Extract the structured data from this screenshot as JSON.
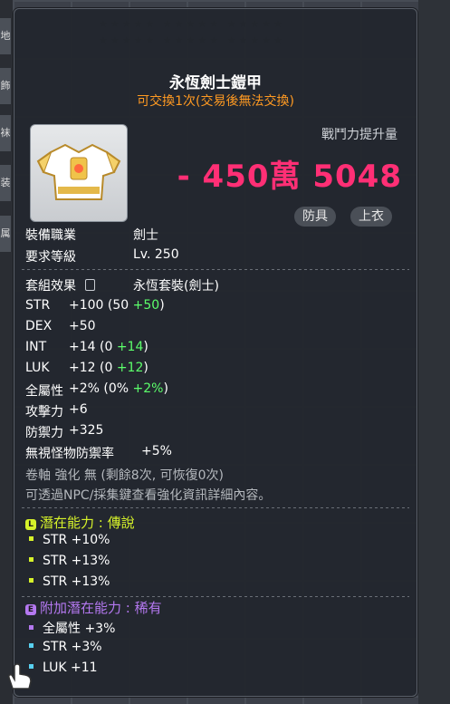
{
  "background": {
    "left_chars": [
      "地",
      "飾",
      "袜",
      "装",
      "属"
    ]
  },
  "item": {
    "name": "永恆劍士鎧甲",
    "trade_note": "可交換1次(交易後無法交換)",
    "combat_power_label": "戰鬥力提升量",
    "combat_power_value": "- 450萬 5048",
    "tags": [
      "防具",
      "上衣"
    ],
    "req_job_label": "裝備職業",
    "req_job_value": "劍士",
    "req_level_label": "要求等級",
    "req_level_value": "Lv. 250"
  },
  "set_effect": {
    "label": "套組效果",
    "value": "永恆套裝(劍士)"
  },
  "stats": [
    {
      "name": "STR",
      "total": "+100",
      "detail_open": "(50 ",
      "bonus": "+50",
      "detail_close": ")"
    },
    {
      "name": "DEX",
      "total": "+50",
      "detail_open": "",
      "bonus": "",
      "detail_close": ""
    },
    {
      "name": "INT",
      "total": "+14",
      "detail_open": "(0 ",
      "bonus": "+14",
      "detail_close": ")"
    },
    {
      "name": "LUK",
      "total": "+12",
      "detail_open": "(0 ",
      "bonus": "+12",
      "detail_close": ")"
    },
    {
      "name": "全屬性",
      "total": "+2%",
      "detail_open": "(0% ",
      "bonus": "+2%",
      "detail_close": ")"
    },
    {
      "name": "攻擊力",
      "total": "+6",
      "detail_open": "",
      "bonus": "",
      "detail_close": ""
    },
    {
      "name": "防禦力",
      "total": "+325",
      "detail_open": "",
      "bonus": "",
      "detail_close": ""
    },
    {
      "name": "無視怪物防禦率",
      "total": "+5%",
      "detail_open": "",
      "bonus": "",
      "detail_close": ""
    }
  ],
  "scroll_info": "卷軸 強化 無 (剩餘8次, 可恢復0次)",
  "npc_info": "可透過NPC/採集鍵查看強化資訊詳細內容。",
  "potential": {
    "icon": "L",
    "label": "潛在能力 : 傳說",
    "color": "#d6f22a",
    "lines": [
      "STR +10%",
      "STR +13%",
      "STR +13%"
    ]
  },
  "additional_potential": {
    "icon": "E",
    "label": "附加潛在能力 : 稀有",
    "color": "#b478f0",
    "lines": [
      "全屬性 +3%",
      "STR +3%",
      "LUK +11"
    ],
    "bullet_colors": [
      "#b478f0",
      "#58d0f0",
      "#58d0f0"
    ]
  }
}
